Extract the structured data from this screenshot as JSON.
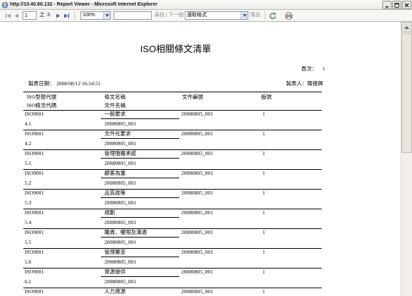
{
  "window": {
    "title": "http://10.40.60.132 - Report Viewer - Microsoft Internet Explorer"
  },
  "toolbar": {
    "page_current": "1",
    "of_label": "之",
    "page_total": "3",
    "zoom": "100%",
    "find_label": "尋找",
    "divider": "|",
    "next_label": "下一個",
    "format_select": "選取格式",
    "export_label": "匯出"
  },
  "report": {
    "title": "ISO相關條文清單",
    "page_label": "頁次：",
    "page_number": "1",
    "date_label": "製表日期：",
    "date_value": "2008/08/12 16:54:51",
    "author_label": "製表人：",
    "author_value": "陳振興",
    "columns": {
      "type": "ISO型態代號",
      "clause_name": "條文名稱",
      "doc_no": "文件編號",
      "version": "版號",
      "clause_code": "ISO條文代碼",
      "doc_name": "文件名稱"
    },
    "rows": [
      {
        "type": "ISO9001",
        "clause_name": "一般要求",
        "doc_no": "20080805_001",
        "version": "1",
        "clause_code": "4.1",
        "doc_name": "20080805_001"
      },
      {
        "type": "ISO9001",
        "clause_name": "文件化要求",
        "doc_no": "20080805_001",
        "version": "1",
        "clause_code": "4.2",
        "doc_name": "20080805_001"
      },
      {
        "type": "ISO9001",
        "clause_name": "管理階層承諾",
        "doc_no": "20080805_001",
        "version": "1",
        "clause_code": "5.1",
        "doc_name": "20080805_001"
      },
      {
        "type": "ISO9001",
        "clause_name": "顧客為重",
        "doc_no": "20080805_001",
        "version": "1",
        "clause_code": "5.2",
        "doc_name": "20080805_001"
      },
      {
        "type": "ISO9001",
        "clause_name": "品質政策",
        "doc_no": "20080805_001",
        "version": "1",
        "clause_code": "5.3",
        "doc_name": "20080805_001"
      },
      {
        "type": "ISO9001",
        "clause_name": "規劃",
        "doc_no": "20080805_001",
        "version": "1",
        "clause_code": "5.4",
        "doc_name": "20080805_001"
      },
      {
        "type": "ISO9001",
        "clause_name": "職責、權限及溝通",
        "doc_no": "20080805_001",
        "version": "1",
        "clause_code": "5.5",
        "doc_name": "20080805_001"
      },
      {
        "type": "ISO9001",
        "clause_name": "管理審查",
        "doc_no": "20080805_001",
        "version": "1",
        "clause_code": "5.6",
        "doc_name": "20080805_001"
      },
      {
        "type": "ISO9001",
        "clause_name": "資源提供",
        "doc_no": "20080805_001",
        "version": "1",
        "clause_code": "6.1",
        "doc_name": "20080805_001"
      },
      {
        "type": "ISO9001",
        "clause_name": "人力資源",
        "doc_no": "20080805_001",
        "version": "1"
      }
    ]
  }
}
